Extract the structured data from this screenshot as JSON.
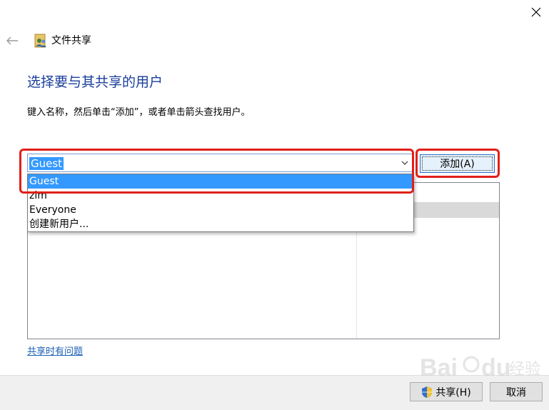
{
  "window": {
    "title": "文件共享"
  },
  "header": {
    "heading": "选择要与其共享的用户",
    "instruction": "键入名称，然后单击“添加”，或者单击箭头查找用户。"
  },
  "combo": {
    "value": "Guest"
  },
  "add_button": {
    "label": "添加(A)"
  },
  "dropdown": {
    "options": [
      "Guest",
      "zlm",
      "Everyone",
      "创建新用户..."
    ],
    "selected_index": 0
  },
  "help_link": "共享时有问题",
  "footer": {
    "share_label": "共享(H)",
    "cancel_label": "取消"
  },
  "watermark": {
    "text": "Baidu 经验"
  },
  "colors": {
    "heading": "#1a3e9c",
    "selection": "#3399ff",
    "annotation": "#e0201a",
    "link": "#1a5fb4"
  },
  "icons": {
    "close": "close-icon",
    "back": "back-arrow-icon",
    "app": "users-share-icon",
    "dropdown": "chevron-down-icon",
    "shield": "uac-shield-icon"
  }
}
